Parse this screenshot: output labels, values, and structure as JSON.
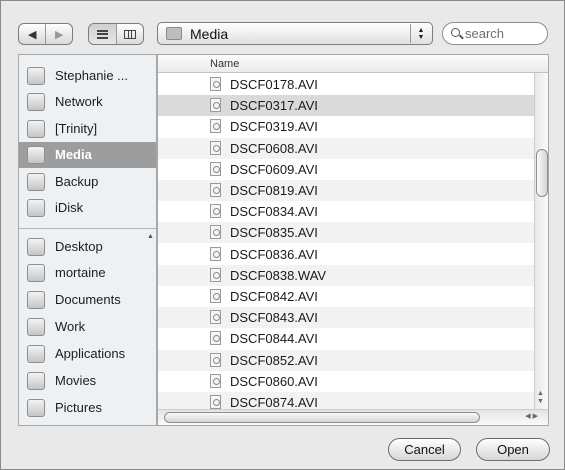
{
  "toolbar": {
    "back_icon": "◀",
    "forward_icon": "▶",
    "location": "Media",
    "search_placeholder": "search"
  },
  "sidebar": {
    "devices": [
      {
        "label": "Stephanie ...",
        "icon": "computer-icon"
      },
      {
        "label": "Network",
        "icon": "network-globe-icon"
      },
      {
        "label": "[Trinity]",
        "icon": "hard-drive-icon"
      },
      {
        "label": "Media",
        "icon": "hard-drive-icon",
        "selected": true
      },
      {
        "label": "Backup",
        "icon": "hard-drive-icon"
      },
      {
        "label": "iDisk",
        "icon": "idisk-icon"
      }
    ],
    "places": [
      {
        "label": "Desktop",
        "icon": "desktop-icon"
      },
      {
        "label": "mortaine",
        "icon": "home-icon"
      },
      {
        "label": "Documents",
        "icon": "documents-icon"
      },
      {
        "label": "Work",
        "icon": "folder-icon"
      },
      {
        "label": "Applications",
        "icon": "applications-icon"
      },
      {
        "label": "Movies",
        "icon": "movies-icon"
      },
      {
        "label": "Pictures",
        "icon": "pictures-icon"
      }
    ]
  },
  "file_list": {
    "column_header": "Name",
    "selected_file": "DSCF0317.AVI",
    "files": [
      "DSCF0178.AVI",
      "DSCF0317.AVI",
      "DSCF0319.AVI",
      "DSCF0608.AVI",
      "DSCF0609.AVI",
      "DSCF0819.AVI",
      "DSCF0834.AVI",
      "DSCF0835.AVI",
      "DSCF0836.AVI",
      "DSCF0838.WAV",
      "DSCF0842.AVI",
      "DSCF0843.AVI",
      "DSCF0844.AVI",
      "DSCF0852.AVI",
      "DSCF0860.AVI",
      "DSCF0874.AVI"
    ]
  },
  "buttons": {
    "cancel": "Cancel",
    "open": "Open"
  }
}
